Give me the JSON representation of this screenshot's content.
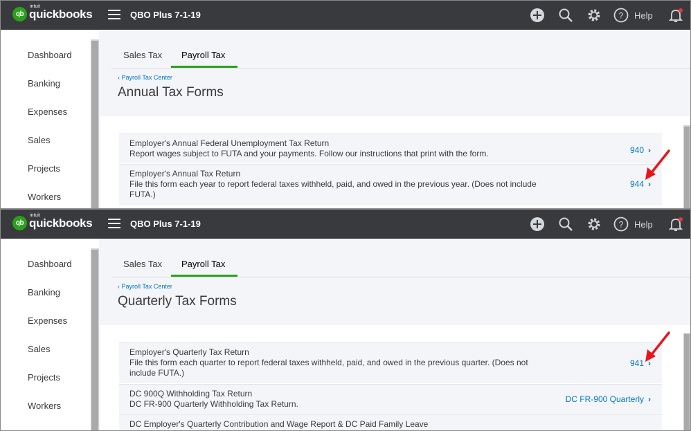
{
  "app": {
    "logo_small": "intuit",
    "logo_text": "quickbooks",
    "logo_badge": "qb",
    "company": "QBO Plus 7-1-19",
    "help_label": "Help"
  },
  "sidebar": {
    "items": [
      "Dashboard",
      "Banking",
      "Expenses",
      "Sales",
      "Projects",
      "Workers"
    ]
  },
  "tabs": [
    "Sales Tax",
    "Payroll Tax"
  ],
  "active_tab": "Payroll Tax",
  "breadcrumb": "Payroll Tax Center",
  "top_panel": {
    "title": "Annual Tax Forms",
    "rows": [
      {
        "title": "Employer's Annual Federal Unemployment Tax Return",
        "desc": "Report wages subject to FUTA and your payments. Follow our instructions that print with the form.",
        "link": "940"
      },
      {
        "title": "Employer's Annual Tax Return",
        "desc": "File this form each year to report federal taxes withheld, paid, and owed in the previous year. (Does not include FUTA.)",
        "link": "944"
      }
    ]
  },
  "bottom_panel": {
    "title": "Quarterly Tax Forms",
    "rows": [
      {
        "title": "Employer's Quarterly Tax Return",
        "desc": "File this form each quarter to report federal taxes withheld, paid, and owed in the previous quarter. (Does not include FUTA.)",
        "link": "941"
      },
      {
        "title": "DC 900Q Withholding Tax Return",
        "desc": "DC FR-900 Quarterly Withholding Tax Return.",
        "link": "DC FR-900 Quarterly"
      },
      {
        "title": "DC Employer's Quarterly Contribution and Wage Report & DC Paid Family Leave",
        "desc": "",
        "link": ""
      }
    ]
  },
  "colors": {
    "topbar": "#393a3d",
    "brand_green": "#2ca01c",
    "link_blue": "#0077c5",
    "arrow_red": "#e8161a"
  }
}
